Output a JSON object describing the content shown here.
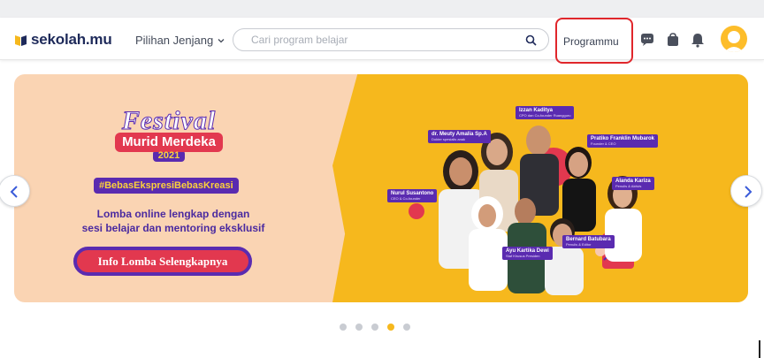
{
  "header": {
    "logo_text": "sekolah.mu",
    "jenjang_label": "Pilihan Jenjang",
    "search_placeholder": "Cari program belajar",
    "programmu_label": "Programmu",
    "icons": [
      "chat-icon",
      "bag-icon",
      "bell-icon",
      "avatar"
    ]
  },
  "banner": {
    "festival_title": "Festival",
    "festival_subtitle": "Murid Merdeka",
    "festival_year": "2021",
    "hashtag": "#BebasEkspresiBebasKreasi",
    "description_line1": "Lomba online lengkap dengan",
    "description_line2": "sesi belajar dan mentoring eksklusif",
    "cta_label": "Info Lomba Selengkapnya",
    "speakers": [
      {
        "name": "Izzan Kaditya",
        "role": "CPO dan Co-founder Ruangguru"
      },
      {
        "name": "dr. Meuty Amalia Sp.A",
        "role": "Dokter spesialis anak"
      },
      {
        "name": "Pratiko Franklin Mubarok",
        "role": "Founder & CEO"
      },
      {
        "name": "Nurul Susantono",
        "role": "CEO & Co-founder"
      },
      {
        "name": "Alanda Kariza",
        "role": "Penulis & Aktivis"
      },
      {
        "name": "Ayu Kartika Dewi",
        "role": "Staf Khusus Presiden"
      },
      {
        "name": "Bernard Batubara",
        "role": "Penulis & Editor"
      }
    ]
  },
  "carousel": {
    "prev_label": "‹",
    "next_label": "›",
    "dot_count": 5,
    "active_index": 3
  },
  "colors": {
    "brand_navy": "#1e2a5a",
    "brand_yellow": "#f6b81d",
    "purple": "#5a2bb0",
    "red": "#e2384f",
    "highlight_box": "#e0262b"
  }
}
